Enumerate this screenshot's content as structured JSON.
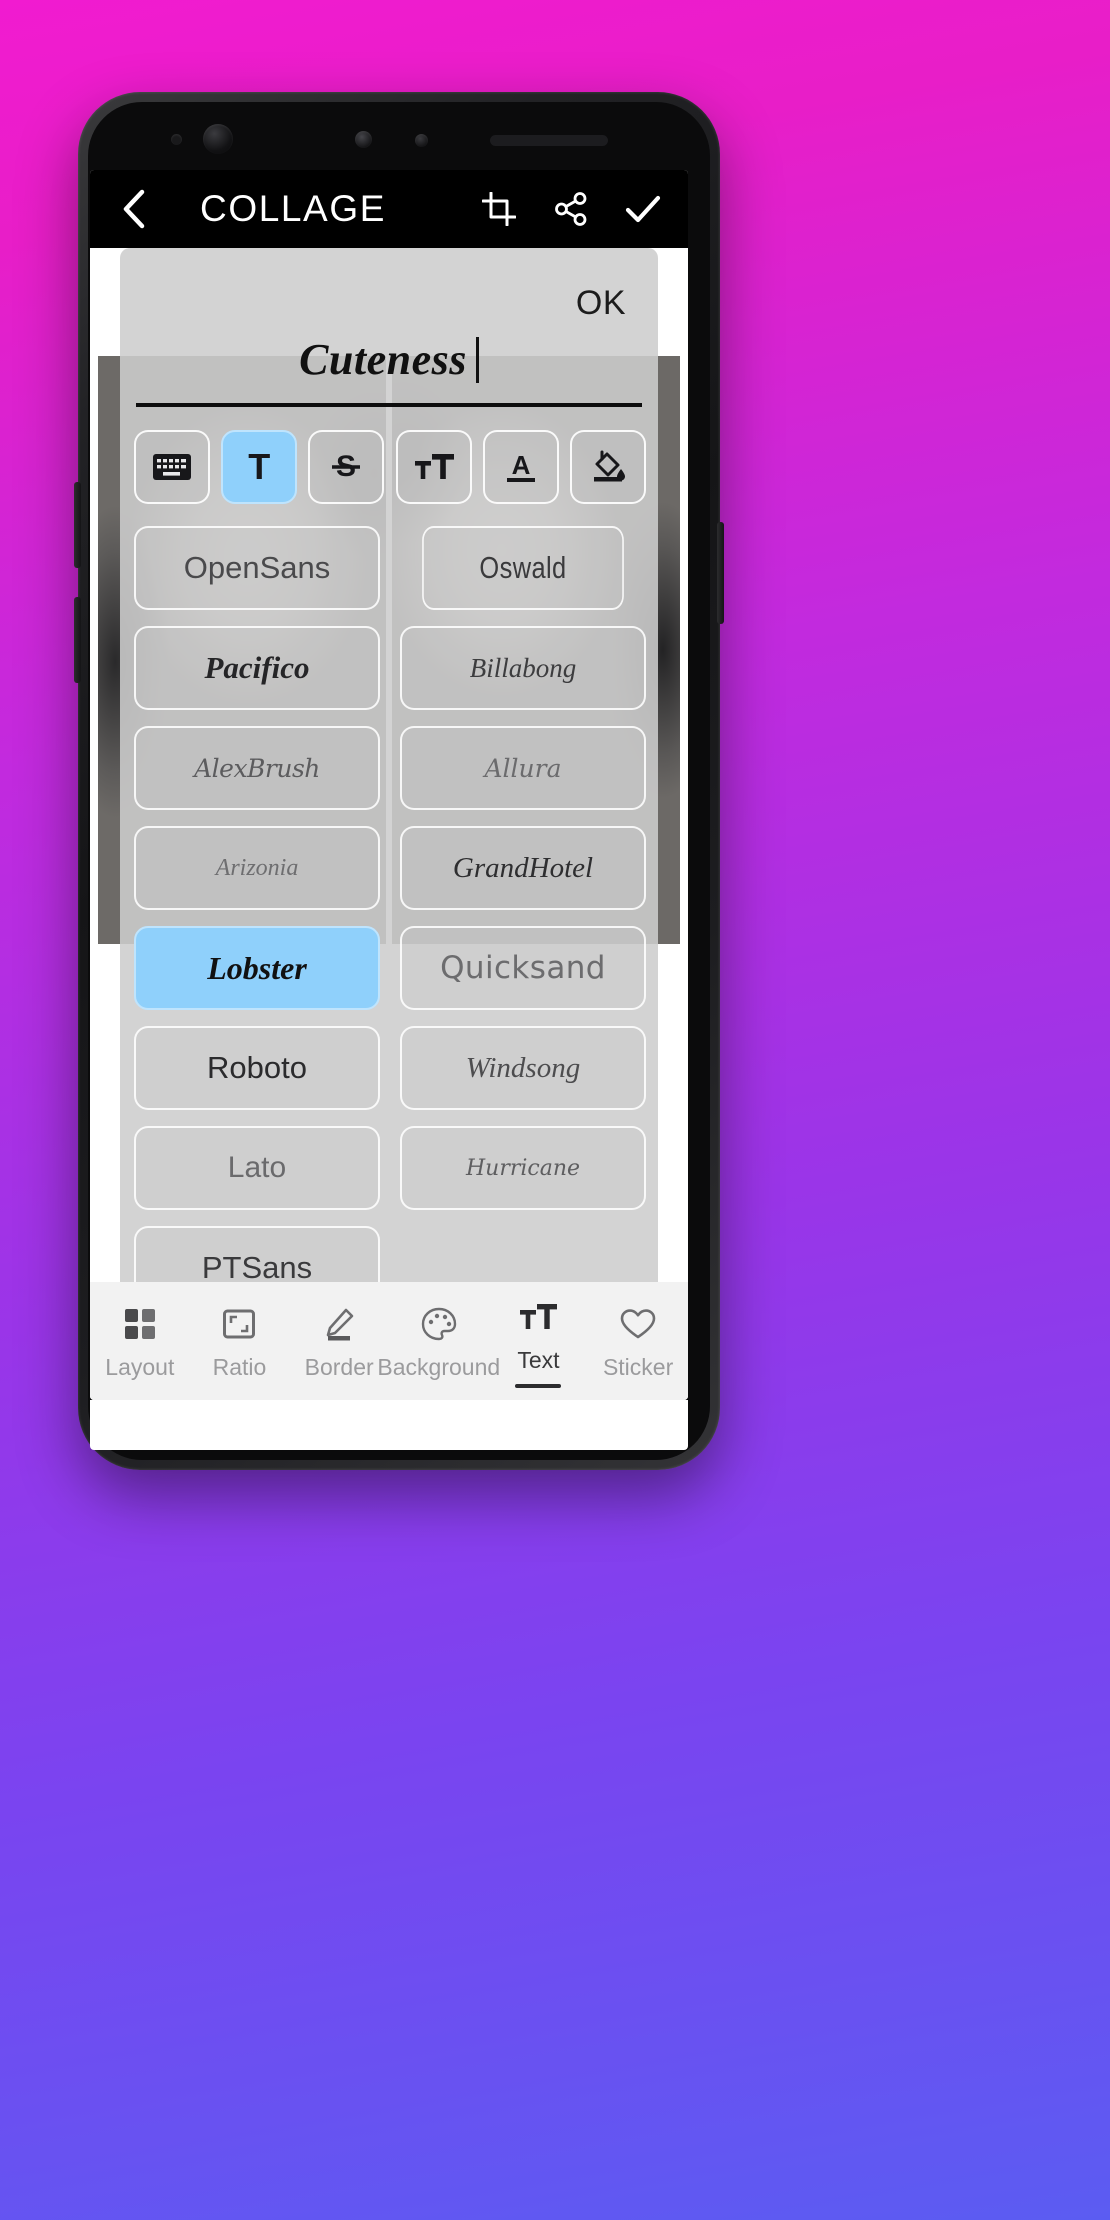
{
  "app": {
    "header": {
      "title": "COLLAGE",
      "back_icon": "chevron-left-icon",
      "actions": [
        {
          "name": "crop-icon",
          "label": "Crop"
        },
        {
          "name": "share-icon",
          "label": "Share"
        },
        {
          "name": "check-icon",
          "label": "Done"
        }
      ]
    },
    "text_editor": {
      "ok_label": "OK",
      "text_value": "Cuteness",
      "caret_visible": true,
      "style_buttons": [
        {
          "id": "keyboard",
          "icon": "keyboard-icon",
          "glyph": "⌨",
          "active": false
        },
        {
          "id": "font",
          "icon": "text-t-icon",
          "glyph": "T",
          "active": true
        },
        {
          "id": "strikethrough",
          "icon": "strikethrough-icon",
          "glyph": "S",
          "active": false
        },
        {
          "id": "text-size",
          "icon": "text-size-icon",
          "glyph": "тT",
          "active": false
        },
        {
          "id": "text-color",
          "icon": "text-color-underline-icon",
          "glyph": "A",
          "active": false
        },
        {
          "id": "fill-color",
          "icon": "paint-bucket-icon",
          "glyph": "",
          "active": false
        }
      ],
      "fonts": [
        {
          "name": "OpenSans",
          "class": "f-opensans",
          "selected": false
        },
        {
          "name": "Oswald",
          "class": "f-oswald",
          "selected": false
        },
        {
          "name": "Pacifico",
          "class": "f-pacifico",
          "selected": false
        },
        {
          "name": "Billabong",
          "class": "f-billabong",
          "selected": false
        },
        {
          "name": "AlexBrush",
          "class": "f-alexbrush",
          "selected": false
        },
        {
          "name": "Allura",
          "class": "f-allura",
          "selected": false
        },
        {
          "name": "Arizonia",
          "class": "f-arizonia",
          "selected": false
        },
        {
          "name": "GrandHotel",
          "class": "f-grandhotel",
          "selected": false
        },
        {
          "name": "Lobster",
          "class": "f-lobster",
          "selected": true
        },
        {
          "name": "Quicksand",
          "class": "f-quicksand",
          "selected": false
        },
        {
          "name": "Roboto",
          "class": "f-roboto",
          "selected": false
        },
        {
          "name": "Windsong",
          "class": "f-windsong",
          "selected": false
        },
        {
          "name": "Lato",
          "class": "f-lato",
          "selected": false
        },
        {
          "name": "Hurricane",
          "class": "f-hurricane",
          "selected": false
        },
        {
          "name": "PTSans",
          "class": "f-ptsans",
          "selected": false
        }
      ]
    },
    "bottom_nav": [
      {
        "label": "Layout",
        "icon": "grid-layout-icon",
        "active": false
      },
      {
        "label": "Ratio",
        "icon": "aspect-ratio-icon",
        "active": false
      },
      {
        "label": "Border",
        "icon": "border-width-icon",
        "active": false
      },
      {
        "label": "Background",
        "icon": "palette-icon",
        "active": false
      },
      {
        "label": "Text",
        "icon": "text-tt-icon",
        "active": true
      },
      {
        "label": "Sticker",
        "icon": "heart-icon",
        "active": false
      }
    ]
  },
  "colors": {
    "accent_selected": "#8fd0fb",
    "header_bg": "#000000",
    "panel_bg": "#cdcdcd",
    "nav_inactive": "#9b9b9d",
    "nav_active": "#3a3a3c"
  }
}
